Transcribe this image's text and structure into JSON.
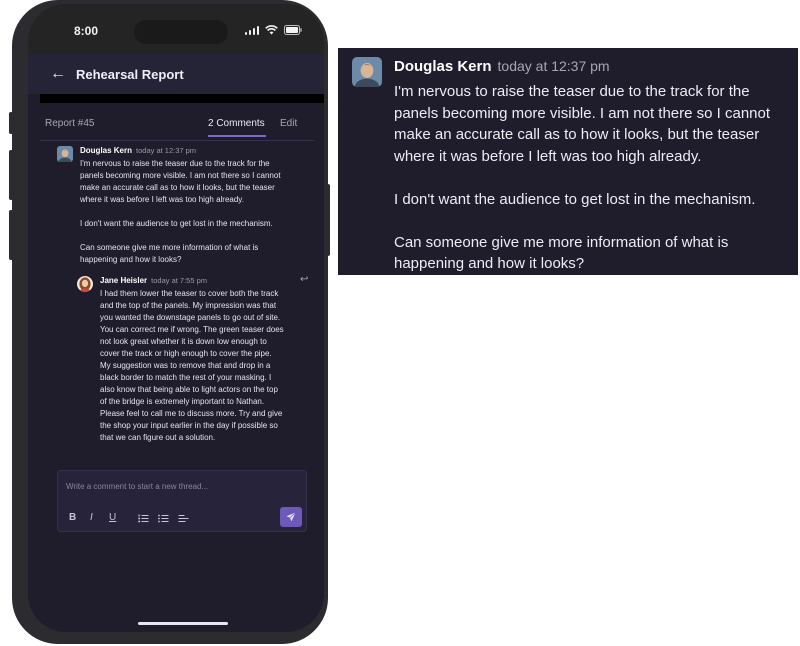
{
  "status_bar": {
    "time": "8:00"
  },
  "header": {
    "title": "Rehearsal Report"
  },
  "tabs": {
    "report": "Report #45",
    "comments": "2 Comments",
    "edit": "Edit"
  },
  "comments": [
    {
      "author": "Douglas Kern",
      "time": "today at 12:37 pm",
      "body": "I'm nervous to raise the teaser due to the track for the\npanels becoming more visible. I am not there so I cannot\nmake an accurate call as to how it looks, but the teaser\nwhere it was before I left was too high already.\n\nI don't want the audience to get lost in the mechanism.\n\nCan someone give me more information of what is\nhappening and how it looks?"
    },
    {
      "author": "Jane Heisler",
      "time": "today at 7:55 pm",
      "body": "I had them lower the teaser to cover both the track\nand the top of the panels. My impression was that\nyou wanted the downstage panels to go out of site.\nYou can correct me if wrong. The green teaser does\nnot look great whether it is down low enough to\ncover the track or high enough to cover the pipe.\nMy suggestion was to remove that and drop in a\nblack border to match the rest of your masking. I\nalso know that being able to light actors on the top\nof the bridge is extremely important to Nathan.\nPlease feel to call me to discuss more. Try and give\nthe shop your input earlier in the day if possible so\nthat we can figure out a solution."
    }
  ],
  "composer": {
    "placeholder": "Write a comment to start a new thread...",
    "bold": "B",
    "italic": "I",
    "underline": "U"
  },
  "zoom": {
    "author": "Douglas Kern",
    "time": "today at 12:37 pm",
    "body": "I'm nervous to raise the teaser due to the track for the\npanels becoming more visible. I am not there so I cannot\nmake an accurate call as to how it looks, but the teaser\nwhere it was before I left was too high already.\n\nI don't want the audience to get lost in the mechanism.\n\nCan someone give me more information of what is\nhappening and how it looks?"
  },
  "icons": [
    "back-arrow-icon",
    "reply-icon",
    "send-icon",
    "ordered-list-icon",
    "bullet-list-icon",
    "align-left-icon",
    "wifi-icon",
    "battery-icon",
    "signal-icon"
  ],
  "colors": {
    "background": "#1f1c2c",
    "accent": "#7b68c8",
    "send_button": "#6e58b8",
    "text": "#e6e4ee"
  }
}
